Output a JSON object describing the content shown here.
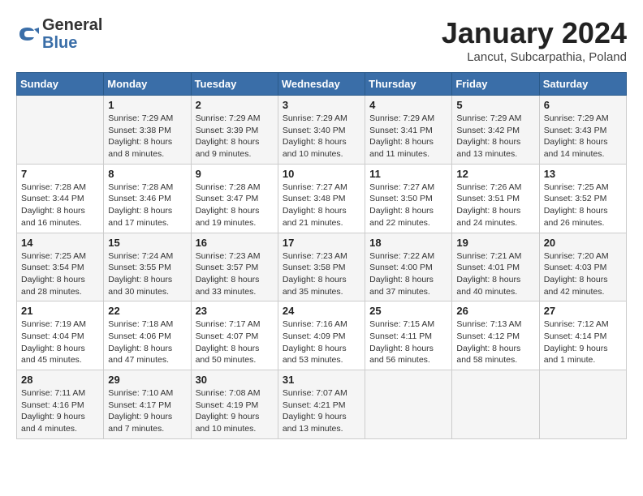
{
  "logo": {
    "general": "General",
    "blue": "Blue"
  },
  "title": "January 2024",
  "subtitle": "Lancut, Subcarpathia, Poland",
  "days_header": [
    "Sunday",
    "Monday",
    "Tuesday",
    "Wednesday",
    "Thursday",
    "Friday",
    "Saturday"
  ],
  "weeks": [
    [
      {
        "day": "",
        "lines": []
      },
      {
        "day": "1",
        "lines": [
          "Sunrise: 7:29 AM",
          "Sunset: 3:38 PM",
          "Daylight: 8 hours",
          "and 8 minutes."
        ]
      },
      {
        "day": "2",
        "lines": [
          "Sunrise: 7:29 AM",
          "Sunset: 3:39 PM",
          "Daylight: 8 hours",
          "and 9 minutes."
        ]
      },
      {
        "day": "3",
        "lines": [
          "Sunrise: 7:29 AM",
          "Sunset: 3:40 PM",
          "Daylight: 8 hours",
          "and 10 minutes."
        ]
      },
      {
        "day": "4",
        "lines": [
          "Sunrise: 7:29 AM",
          "Sunset: 3:41 PM",
          "Daylight: 8 hours",
          "and 11 minutes."
        ]
      },
      {
        "day": "5",
        "lines": [
          "Sunrise: 7:29 AM",
          "Sunset: 3:42 PM",
          "Daylight: 8 hours",
          "and 13 minutes."
        ]
      },
      {
        "day": "6",
        "lines": [
          "Sunrise: 7:29 AM",
          "Sunset: 3:43 PM",
          "Daylight: 8 hours",
          "and 14 minutes."
        ]
      }
    ],
    [
      {
        "day": "7",
        "lines": [
          "Sunrise: 7:28 AM",
          "Sunset: 3:44 PM",
          "Daylight: 8 hours",
          "and 16 minutes."
        ]
      },
      {
        "day": "8",
        "lines": [
          "Sunrise: 7:28 AM",
          "Sunset: 3:46 PM",
          "Daylight: 8 hours",
          "and 17 minutes."
        ]
      },
      {
        "day": "9",
        "lines": [
          "Sunrise: 7:28 AM",
          "Sunset: 3:47 PM",
          "Daylight: 8 hours",
          "and 19 minutes."
        ]
      },
      {
        "day": "10",
        "lines": [
          "Sunrise: 7:27 AM",
          "Sunset: 3:48 PM",
          "Daylight: 8 hours",
          "and 21 minutes."
        ]
      },
      {
        "day": "11",
        "lines": [
          "Sunrise: 7:27 AM",
          "Sunset: 3:50 PM",
          "Daylight: 8 hours",
          "and 22 minutes."
        ]
      },
      {
        "day": "12",
        "lines": [
          "Sunrise: 7:26 AM",
          "Sunset: 3:51 PM",
          "Daylight: 8 hours",
          "and 24 minutes."
        ]
      },
      {
        "day": "13",
        "lines": [
          "Sunrise: 7:25 AM",
          "Sunset: 3:52 PM",
          "Daylight: 8 hours",
          "and 26 minutes."
        ]
      }
    ],
    [
      {
        "day": "14",
        "lines": [
          "Sunrise: 7:25 AM",
          "Sunset: 3:54 PM",
          "Daylight: 8 hours",
          "and 28 minutes."
        ]
      },
      {
        "day": "15",
        "lines": [
          "Sunrise: 7:24 AM",
          "Sunset: 3:55 PM",
          "Daylight: 8 hours",
          "and 30 minutes."
        ]
      },
      {
        "day": "16",
        "lines": [
          "Sunrise: 7:23 AM",
          "Sunset: 3:57 PM",
          "Daylight: 8 hours",
          "and 33 minutes."
        ]
      },
      {
        "day": "17",
        "lines": [
          "Sunrise: 7:23 AM",
          "Sunset: 3:58 PM",
          "Daylight: 8 hours",
          "and 35 minutes."
        ]
      },
      {
        "day": "18",
        "lines": [
          "Sunrise: 7:22 AM",
          "Sunset: 4:00 PM",
          "Daylight: 8 hours",
          "and 37 minutes."
        ]
      },
      {
        "day": "19",
        "lines": [
          "Sunrise: 7:21 AM",
          "Sunset: 4:01 PM",
          "Daylight: 8 hours",
          "and 40 minutes."
        ]
      },
      {
        "day": "20",
        "lines": [
          "Sunrise: 7:20 AM",
          "Sunset: 4:03 PM",
          "Daylight: 8 hours",
          "and 42 minutes."
        ]
      }
    ],
    [
      {
        "day": "21",
        "lines": [
          "Sunrise: 7:19 AM",
          "Sunset: 4:04 PM",
          "Daylight: 8 hours",
          "and 45 minutes."
        ]
      },
      {
        "day": "22",
        "lines": [
          "Sunrise: 7:18 AM",
          "Sunset: 4:06 PM",
          "Daylight: 8 hours",
          "and 47 minutes."
        ]
      },
      {
        "day": "23",
        "lines": [
          "Sunrise: 7:17 AM",
          "Sunset: 4:07 PM",
          "Daylight: 8 hours",
          "and 50 minutes."
        ]
      },
      {
        "day": "24",
        "lines": [
          "Sunrise: 7:16 AM",
          "Sunset: 4:09 PM",
          "Daylight: 8 hours",
          "and 53 minutes."
        ]
      },
      {
        "day": "25",
        "lines": [
          "Sunrise: 7:15 AM",
          "Sunset: 4:11 PM",
          "Daylight: 8 hours",
          "and 56 minutes."
        ]
      },
      {
        "day": "26",
        "lines": [
          "Sunrise: 7:13 AM",
          "Sunset: 4:12 PM",
          "Daylight: 8 hours",
          "and 58 minutes."
        ]
      },
      {
        "day": "27",
        "lines": [
          "Sunrise: 7:12 AM",
          "Sunset: 4:14 PM",
          "Daylight: 9 hours",
          "and 1 minute."
        ]
      }
    ],
    [
      {
        "day": "28",
        "lines": [
          "Sunrise: 7:11 AM",
          "Sunset: 4:16 PM",
          "Daylight: 9 hours",
          "and 4 minutes."
        ]
      },
      {
        "day": "29",
        "lines": [
          "Sunrise: 7:10 AM",
          "Sunset: 4:17 PM",
          "Daylight: 9 hours",
          "and 7 minutes."
        ]
      },
      {
        "day": "30",
        "lines": [
          "Sunrise: 7:08 AM",
          "Sunset: 4:19 PM",
          "Daylight: 9 hours",
          "and 10 minutes."
        ]
      },
      {
        "day": "31",
        "lines": [
          "Sunrise: 7:07 AM",
          "Sunset: 4:21 PM",
          "Daylight: 9 hours",
          "and 13 minutes."
        ]
      },
      {
        "day": "",
        "lines": []
      },
      {
        "day": "",
        "lines": []
      },
      {
        "day": "",
        "lines": []
      }
    ]
  ]
}
